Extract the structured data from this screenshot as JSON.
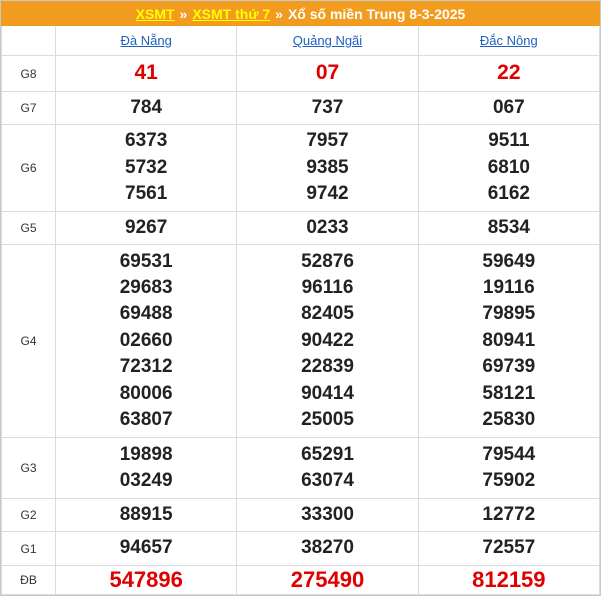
{
  "breadcrumb": {
    "link1": "XSMT",
    "sep1": "»",
    "link2": "XSMT thứ 7",
    "sep2": "»",
    "title": "Xổ số miền Trung 8-3-2025"
  },
  "provinces": [
    "Đà Nẵng",
    "Quảng Ngãi",
    "Đắc Nông"
  ],
  "rows": [
    {
      "label": "G8",
      "values": [
        [
          "41"
        ],
        [
          "07"
        ],
        [
          "22"
        ]
      ]
    },
    {
      "label": "G7",
      "values": [
        [
          "784"
        ],
        [
          "737"
        ],
        [
          "067"
        ]
      ]
    },
    {
      "label": "G6",
      "values": [
        [
          "6373",
          "5732",
          "7561"
        ],
        [
          "7957",
          "9385",
          "9742"
        ],
        [
          "9511",
          "6810",
          "6162"
        ]
      ]
    },
    {
      "label": "G5",
      "values": [
        [
          "9267"
        ],
        [
          "0233"
        ],
        [
          "8534"
        ]
      ]
    },
    {
      "label": "G4",
      "values": [
        [
          "69531",
          "29683",
          "69488",
          "02660",
          "72312",
          "80006",
          "63807"
        ],
        [
          "52876",
          "96116",
          "82405",
          "90422",
          "22839",
          "90414",
          "25005"
        ],
        [
          "59649",
          "19116",
          "79895",
          "80941",
          "69739",
          "58121",
          "25830"
        ]
      ]
    },
    {
      "label": "G3",
      "values": [
        [
          "19898",
          "03249"
        ],
        [
          "65291",
          "63074"
        ],
        [
          "79544",
          "75902"
        ]
      ]
    },
    {
      "label": "G2",
      "values": [
        [
          "88915"
        ],
        [
          "33300"
        ],
        [
          "12772"
        ]
      ]
    },
    {
      "label": "G1",
      "values": [
        [
          "94657"
        ],
        [
          "38270"
        ],
        [
          "72557"
        ]
      ]
    },
    {
      "label": "ĐB",
      "values": [
        [
          "547896"
        ],
        [
          "275490"
        ],
        [
          "812159"
        ]
      ]
    }
  ],
  "colors": {
    "header_bg": "#f29c1f",
    "header_link": "#ffff00",
    "prize_red": "#e00000",
    "province_link": "#1f5fbf"
  }
}
